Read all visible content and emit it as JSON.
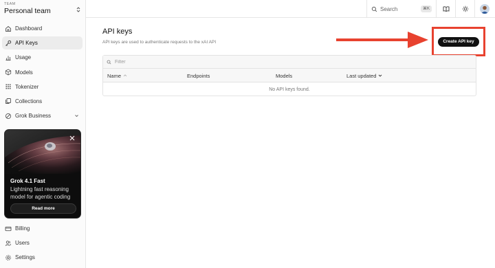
{
  "team": {
    "label": "TEAM",
    "name": "Personal team"
  },
  "nav": [
    {
      "label": "Dashboard",
      "icon": "home-icon"
    },
    {
      "label": "API Keys",
      "icon": "key-icon",
      "active": true
    },
    {
      "label": "Usage",
      "icon": "usage-chart-icon"
    },
    {
      "label": "Models",
      "icon": "cube-icon"
    },
    {
      "label": "Tokenizer",
      "icon": "grid-icon"
    },
    {
      "label": "Collections",
      "icon": "copy-icon"
    },
    {
      "label": "Grok Business",
      "icon": "grok-icon"
    }
  ],
  "nav_bottom": [
    {
      "label": "Billing",
      "icon": "credit-card-icon"
    },
    {
      "label": "Users",
      "icon": "users-icon"
    },
    {
      "label": "Settings",
      "icon": "gear-icon"
    }
  ],
  "promo": {
    "title": "Grok 4.1 Fast",
    "description": "Lightning fast reasoning model for agentic coding",
    "button": "Read more"
  },
  "topbar": {
    "search_label": "Search",
    "search_shortcut": "⌘K"
  },
  "page": {
    "title": "API keys",
    "description": "API keys are used to authenticate requests to the xAI API",
    "create_button": "Create API key"
  },
  "table": {
    "filter_placeholder": "Filter",
    "columns": [
      "Name",
      "Endpoints",
      "Models",
      "Last updated"
    ],
    "empty_text": "No API keys found."
  },
  "colors": {
    "accent_annotation": "#e8422f",
    "button_dark": "#111111"
  }
}
